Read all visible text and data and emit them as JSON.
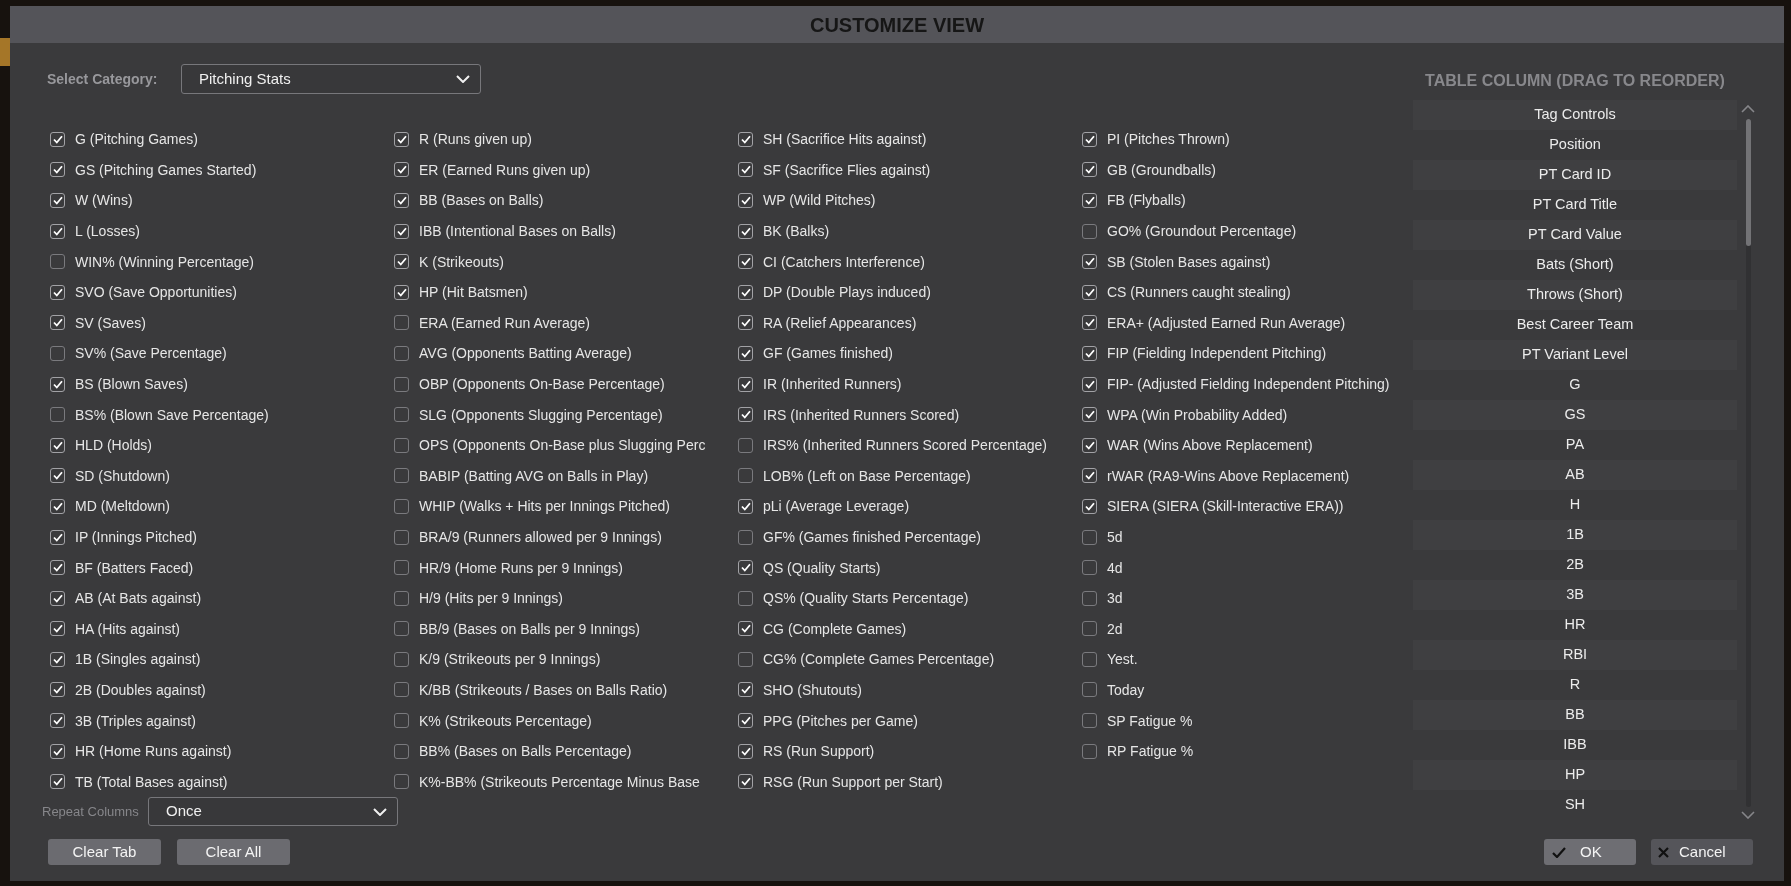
{
  "dialog": {
    "title": "CUSTOMIZE VIEW"
  },
  "category": {
    "label": "Select Category:",
    "value": "Pitching Stats"
  },
  "columns": [
    [
      {
        "label": "G (Pitching Games)",
        "checked": true
      },
      {
        "label": "GS (Pitching Games Started)",
        "checked": true
      },
      {
        "label": "W (Wins)",
        "checked": true
      },
      {
        "label": "L (Losses)",
        "checked": true
      },
      {
        "label": "WIN% (Winning Percentage)",
        "checked": false
      },
      {
        "label": "SVO (Save Opportunities)",
        "checked": true
      },
      {
        "label": "SV (Saves)",
        "checked": true
      },
      {
        "label": "SV% (Save Percentage)",
        "checked": false
      },
      {
        "label": "BS (Blown Saves)",
        "checked": true
      },
      {
        "label": "BS% (Blown Save Percentage)",
        "checked": false
      },
      {
        "label": "HLD (Holds)",
        "checked": true
      },
      {
        "label": "SD (Shutdown)",
        "checked": true
      },
      {
        "label": "MD (Meltdown)",
        "checked": true
      },
      {
        "label": "IP (Innings Pitched)",
        "checked": true
      },
      {
        "label": "BF (Batters Faced)",
        "checked": true
      },
      {
        "label": "AB (At Bats against)",
        "checked": true
      },
      {
        "label": "HA (Hits against)",
        "checked": true
      },
      {
        "label": "1B (Singles against)",
        "checked": true
      },
      {
        "label": "2B (Doubles against)",
        "checked": true
      },
      {
        "label": "3B (Triples against)",
        "checked": true
      },
      {
        "label": "HR (Home Runs against)",
        "checked": true
      },
      {
        "label": "TB (Total Bases against)",
        "checked": true
      }
    ],
    [
      {
        "label": "R (Runs given up)",
        "checked": true
      },
      {
        "label": "ER (Earned Runs given up)",
        "checked": true
      },
      {
        "label": "BB (Bases on Balls)",
        "checked": true
      },
      {
        "label": "IBB (Intentional Bases on Balls)",
        "checked": true
      },
      {
        "label": "K (Strikeouts)",
        "checked": true
      },
      {
        "label": "HP (Hit Batsmen)",
        "checked": true
      },
      {
        "label": "ERA (Earned Run Average)",
        "checked": false
      },
      {
        "label": "AVG (Opponents Batting Average)",
        "checked": false
      },
      {
        "label": "OBP (Opponents On-Base Percentage)",
        "checked": false
      },
      {
        "label": "SLG (Opponents Slugging Percentage)",
        "checked": false
      },
      {
        "label": "OPS (Opponents On-Base plus Slugging Perc",
        "checked": false
      },
      {
        "label": "BABIP (Batting AVG on Balls in Play)",
        "checked": false
      },
      {
        "label": "WHIP (Walks + Hits per Innings Pitched)",
        "checked": false
      },
      {
        "label": "BRA/9 (Runners allowed per 9 Innings)",
        "checked": false
      },
      {
        "label": "HR/9 (Home Runs per 9 Innings)",
        "checked": false
      },
      {
        "label": "H/9 (Hits per 9 Innings)",
        "checked": false
      },
      {
        "label": "BB/9 (Bases on Balls per 9 Innings)",
        "checked": false
      },
      {
        "label": "K/9 (Strikeouts per 9 Innings)",
        "checked": false
      },
      {
        "label": "K/BB (Strikeouts / Bases on Balls Ratio)",
        "checked": false
      },
      {
        "label": "K% (Strikeouts Percentage)",
        "checked": false
      },
      {
        "label": "BB% (Bases on Balls Percentage)",
        "checked": false
      },
      {
        "label": "K%-BB% (Strikeouts Percentage Minus Base",
        "checked": false
      }
    ],
    [
      {
        "label": "SH (Sacrifice Hits against)",
        "checked": true
      },
      {
        "label": "SF (Sacrifice Flies against)",
        "checked": true
      },
      {
        "label": "WP (Wild Pitches)",
        "checked": true
      },
      {
        "label": "BK (Balks)",
        "checked": true
      },
      {
        "label": "CI (Catchers Interference)",
        "checked": true
      },
      {
        "label": "DP (Double Plays induced)",
        "checked": true
      },
      {
        "label": "RA (Relief Appearances)",
        "checked": true
      },
      {
        "label": "GF (Games finished)",
        "checked": true
      },
      {
        "label": "IR (Inherited Runners)",
        "checked": true
      },
      {
        "label": "IRS (Inherited Runners Scored)",
        "checked": true
      },
      {
        "label": "IRS% (Inherited Runners Scored Percentage)",
        "checked": false
      },
      {
        "label": "LOB% (Left on Base Percentage)",
        "checked": false
      },
      {
        "label": "pLi (Average Leverage)",
        "checked": true
      },
      {
        "label": "GF% (Games finished Percentage)",
        "checked": false
      },
      {
        "label": "QS (Quality Starts)",
        "checked": true
      },
      {
        "label": "QS% (Quality Starts Percentage)",
        "checked": false
      },
      {
        "label": "CG (Complete Games)",
        "checked": true
      },
      {
        "label": "CG% (Complete Games Percentage)",
        "checked": false
      },
      {
        "label": "SHO (Shutouts)",
        "checked": true
      },
      {
        "label": "PPG (Pitches per Game)",
        "checked": true
      },
      {
        "label": "RS (Run Support)",
        "checked": true
      },
      {
        "label": "RSG (Run Support per Start)",
        "checked": true
      }
    ],
    [
      {
        "label": "PI (Pitches Thrown)",
        "checked": true
      },
      {
        "label": "GB (Groundballs)",
        "checked": true
      },
      {
        "label": "FB (Flyballs)",
        "checked": true
      },
      {
        "label": "GO% (Groundout Percentage)",
        "checked": false
      },
      {
        "label": "SB (Stolen Bases against)",
        "checked": true
      },
      {
        "label": "CS (Runners caught stealing)",
        "checked": true
      },
      {
        "label": "ERA+ (Adjusted Earned Run Average)",
        "checked": true
      },
      {
        "label": "FIP (Fielding Independent Pitching)",
        "checked": true
      },
      {
        "label": "FIP- (Adjusted Fielding Independent Pitching)",
        "checked": true
      },
      {
        "label": "WPA (Win Probability Added)",
        "checked": true
      },
      {
        "label": "WAR (Wins Above Replacement)",
        "checked": true
      },
      {
        "label": "rWAR (RA9-Wins Above Replacement)",
        "checked": true
      },
      {
        "label": "SIERA (SIERA (Skill-Interactive ERA))",
        "checked": true
      },
      {
        "label": "5d",
        "checked": false
      },
      {
        "label": "4d",
        "checked": false
      },
      {
        "label": "3d",
        "checked": false
      },
      {
        "label": "2d",
        "checked": false
      },
      {
        "label": "Yest.",
        "checked": false
      },
      {
        "label": "Today",
        "checked": false
      },
      {
        "label": "SP Fatigue %",
        "checked": false
      },
      {
        "label": "RP Fatigue %",
        "checked": false
      }
    ]
  ],
  "repeat": {
    "label": "Repeat Columns",
    "value": "Once"
  },
  "table_columns": {
    "title": "TABLE COLUMN (DRAG TO REORDER)",
    "items": [
      "Tag Controls",
      "Position",
      "PT Card ID",
      "PT Card Title",
      "PT Card Value",
      "Bats (Short)",
      "Throws (Short)",
      "Best Career Team",
      "PT Variant Level",
      "G",
      "GS",
      "PA",
      "AB",
      "H",
      "1B",
      "2B",
      "3B",
      "HR",
      "RBI",
      "R",
      "BB",
      "IBB",
      "HP",
      "SH"
    ]
  },
  "buttons": [
    {
      "label": "Clear Tab",
      "kind": "plain"
    },
    {
      "label": "Clear All",
      "kind": "plain"
    },
    {
      "label": "OK",
      "kind": "confirm"
    },
    {
      "label": "Cancel",
      "kind": "cancel"
    }
  ]
}
